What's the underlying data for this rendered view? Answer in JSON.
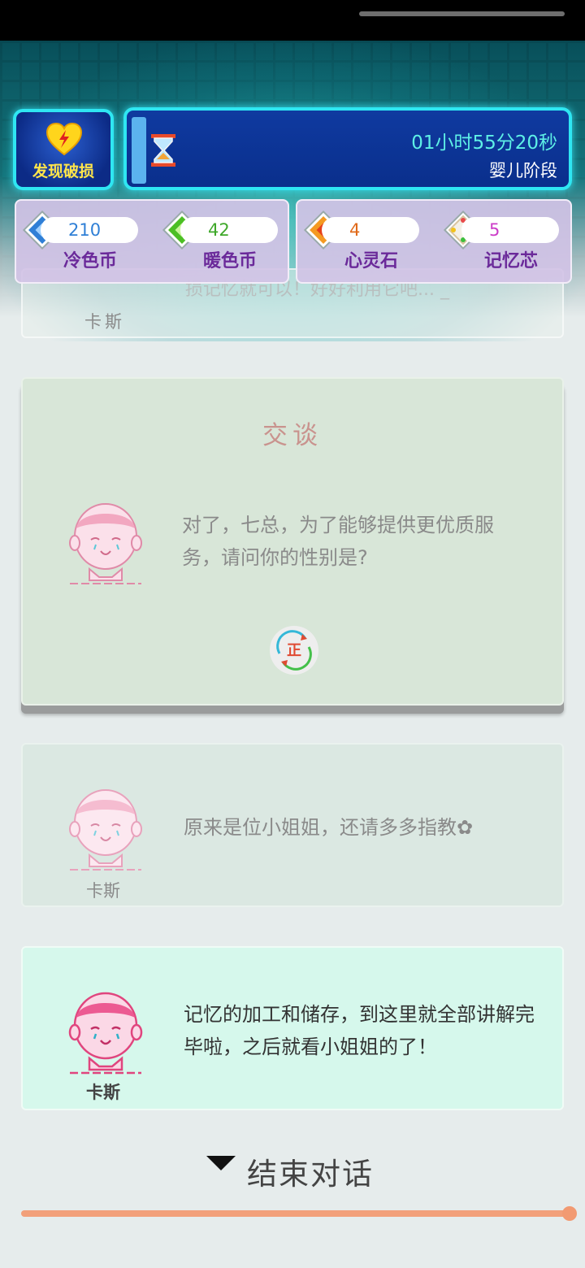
{
  "header": {
    "damage_button_label": "发现破损",
    "timer": "01小时55分20秒",
    "stage": "婴儿阶段"
  },
  "currencies": [
    {
      "name": "冷色币",
      "value": "210",
      "color": "#2f7fd6",
      "icon": "blue-diamond-gem-icon"
    },
    {
      "name": "暖色币",
      "value": "42",
      "color": "#3fa82a",
      "icon": "green-diamond-gem-icon"
    },
    {
      "name": "心灵石",
      "value": "4",
      "color": "#e06a1a",
      "icon": "orange-diamond-gem-icon"
    },
    {
      "name": "记忆芯",
      "value": "5",
      "color": "#cc3cc8",
      "icon": "rainbow-diamond-gem-icon"
    }
  ],
  "dialog": {
    "faded_text": "损记忆就可以！好好利用它吧... _",
    "faded_speaker": "卡斯",
    "talk_title": "交谈",
    "talk_question": "对了，七总，为了能够提供更优质服务，请问你的性别是?",
    "correct_label": "正",
    "reply_text": "原来是位小姐姐，还请多多指教✿",
    "reply_speaker": "卡斯",
    "last_text": "记忆的加工和储存，到这里就全部讲解完毕啦，之后就看小姐姐的了！",
    "last_speaker": "卡斯"
  },
  "end_button_label": "结束对话",
  "progress": 1.0,
  "colors": {
    "accent_cyan": "#2fe6f2",
    "timer_text": "#5ef0e6",
    "progress": "#f2a07a"
  }
}
